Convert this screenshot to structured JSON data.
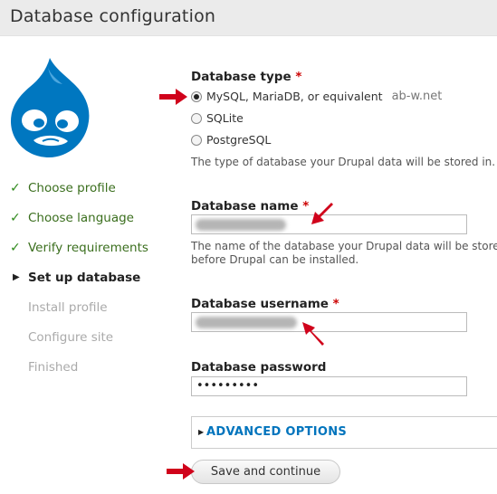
{
  "header": {
    "title": "Database configuration"
  },
  "logo": {
    "name": "drupal-logo",
    "color": "#0077c0"
  },
  "steps": [
    {
      "label": "Choose profile",
      "state": "done"
    },
    {
      "label": "Choose language",
      "state": "done"
    },
    {
      "label": "Verify requirements",
      "state": "done"
    },
    {
      "label": "Set up database",
      "state": "current"
    },
    {
      "label": "Install profile",
      "state": "todo"
    },
    {
      "label": "Configure site",
      "state": "todo"
    },
    {
      "label": "Finished",
      "state": "todo"
    }
  ],
  "db_type": {
    "label": "Database type",
    "required_mark": "*",
    "options": [
      {
        "label": "MySQL, MariaDB, or equivalent",
        "selected": true
      },
      {
        "label": "SQLite",
        "selected": false
      },
      {
        "label": "PostgreSQL",
        "selected": false
      }
    ],
    "watermark": "ab-w.net",
    "description": "The type of database your Drupal data will be stored in."
  },
  "db_name": {
    "label": "Database name",
    "required_mark": "*",
    "value_obscured": true,
    "description_line1": "The name of the database your Drupal data will be stored",
    "description_line2": "before Drupal can be installed."
  },
  "db_user": {
    "label": "Database username",
    "required_mark": "*",
    "value_obscured": true
  },
  "db_pass": {
    "label": "Database password",
    "value": "•••••••••"
  },
  "advanced": {
    "label": "ADVANCED OPTIONS"
  },
  "submit": {
    "label": "Save and continue"
  },
  "colors": {
    "accent_link": "#0074bd",
    "required": "#cc0000",
    "done_step": "#3a6e1d",
    "arrow": "#d0021b"
  }
}
